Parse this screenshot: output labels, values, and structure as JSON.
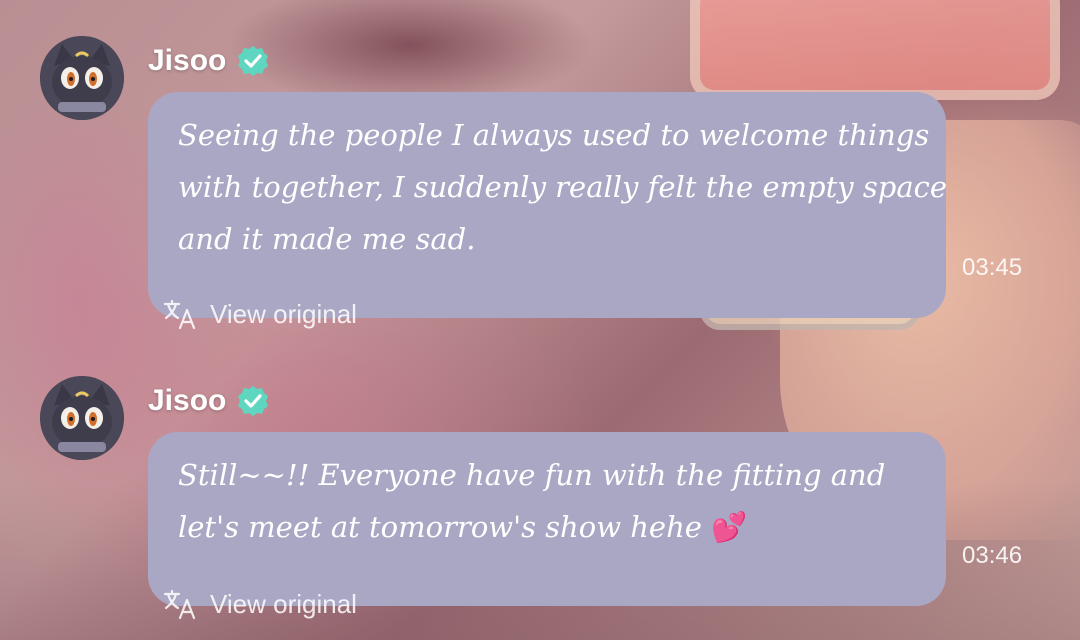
{
  "messages": [
    {
      "sender": "Jisoo",
      "text_lines": [
        "Seeing the people I always used to welcome things",
        "with together, I suddenly really felt the empty space",
        "and it made me sad."
      ],
      "time": "03:45",
      "view_original_label": "View original"
    },
    {
      "sender": "Jisoo",
      "text_lines": [
        "Still~~!! Everyone have fun with the fitting and",
        "let's meet at tomorrow's show hehe "
      ],
      "emoji": "💕",
      "time": "03:46",
      "view_original_label": "View original"
    }
  ],
  "icons": {
    "avatar": "black-cat-avatar-icon",
    "verified": "verified-badge-icon",
    "translate": "translate-icon"
  },
  "colors": {
    "bubble": "#a9a7c4",
    "verified_badge": "#5fd6c0",
    "text": "#ffffff"
  }
}
